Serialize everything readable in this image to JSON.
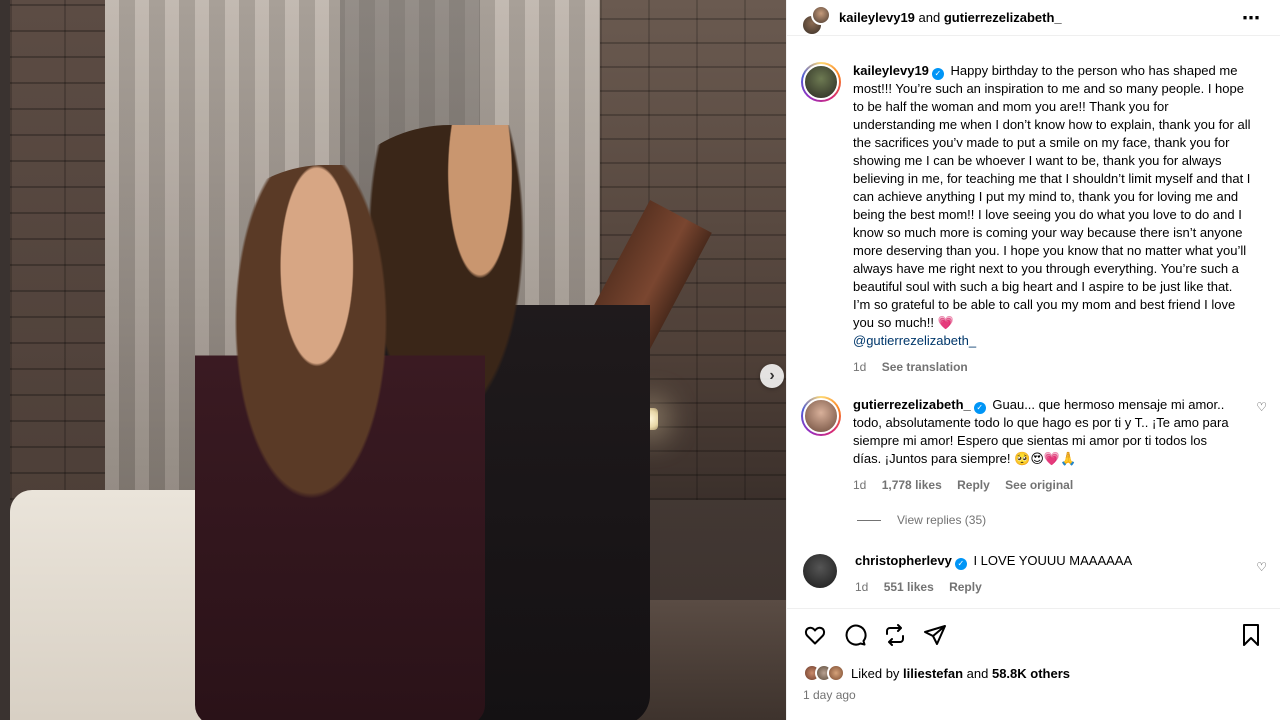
{
  "post": {
    "header": {
      "user1": "kaileylevy19",
      "joiner": "and",
      "user2": "gutierrezelizabeth_"
    },
    "caption": {
      "username": "kaileylevy19",
      "text": "Happy birthday to the person who has shaped me most!!! You’re such an inspiration to me and so many people. I hope to be half the woman and mom you are!! Thank you for understanding me when I don’t know how to explain, thank you for all the sacrifices you’v made to put a smile on my face, thank you for showing me I can be whoever I want to be, thank you for always believing in me, for teaching me that I shouldn’t limit myself and that I can achieve anything I put my mind to, thank you for loving me and being the best mom!! I love seeing you do what you love to do and I know so much more is coming your way because there isn’t anyone more deserving than you. I hope you know that no matter what you’ll always have me right next to you through everything. You’re such a beautiful soul with such a big heart and I aspire to be just like that. I’m so grateful to be able to call you my mom and best friend I love you so much!!",
      "emoji": "💗",
      "mention": "@gutierrezelizabeth_",
      "time": "1d",
      "see_translation": "See translation"
    },
    "comments": [
      {
        "username": "gutierrezelizabeth_",
        "text": "Guau... que hermoso mensaje mi amor.. todo, absolutamente todo lo que hago es por ti y T.. ¡Te amo para siempre mi amor! Espero que sientas mi amor por ti todos los días. ¡Juntos para siempre!",
        "emojis": "🥺😍💗🙏",
        "time": "1d",
        "likes": "1,778 likes",
        "reply": "Reply",
        "see_original": "See original",
        "view_replies": "View replies (35)"
      },
      {
        "username": "christopherlevy",
        "text": "I LOVE YOUUU MAAAAAA",
        "time": "1d",
        "likes": "551 likes",
        "reply": "Reply"
      }
    ],
    "likes": {
      "prefix": "Liked by",
      "user": "liliestefan",
      "joiner": "and",
      "others": "58.8K others"
    },
    "time_ago": "1 day ago"
  },
  "icons": {
    "more": "more-options-icon",
    "next": "chevron-right-icon",
    "like": "heart-icon",
    "comment": "comment-icon",
    "repost": "repost-icon",
    "share": "share-icon",
    "save": "bookmark-icon",
    "verified": "verified-badge-icon"
  },
  "colors": {
    "verified": "#0095f6",
    "secondary_text": "#737373",
    "mention": "#00376b"
  }
}
